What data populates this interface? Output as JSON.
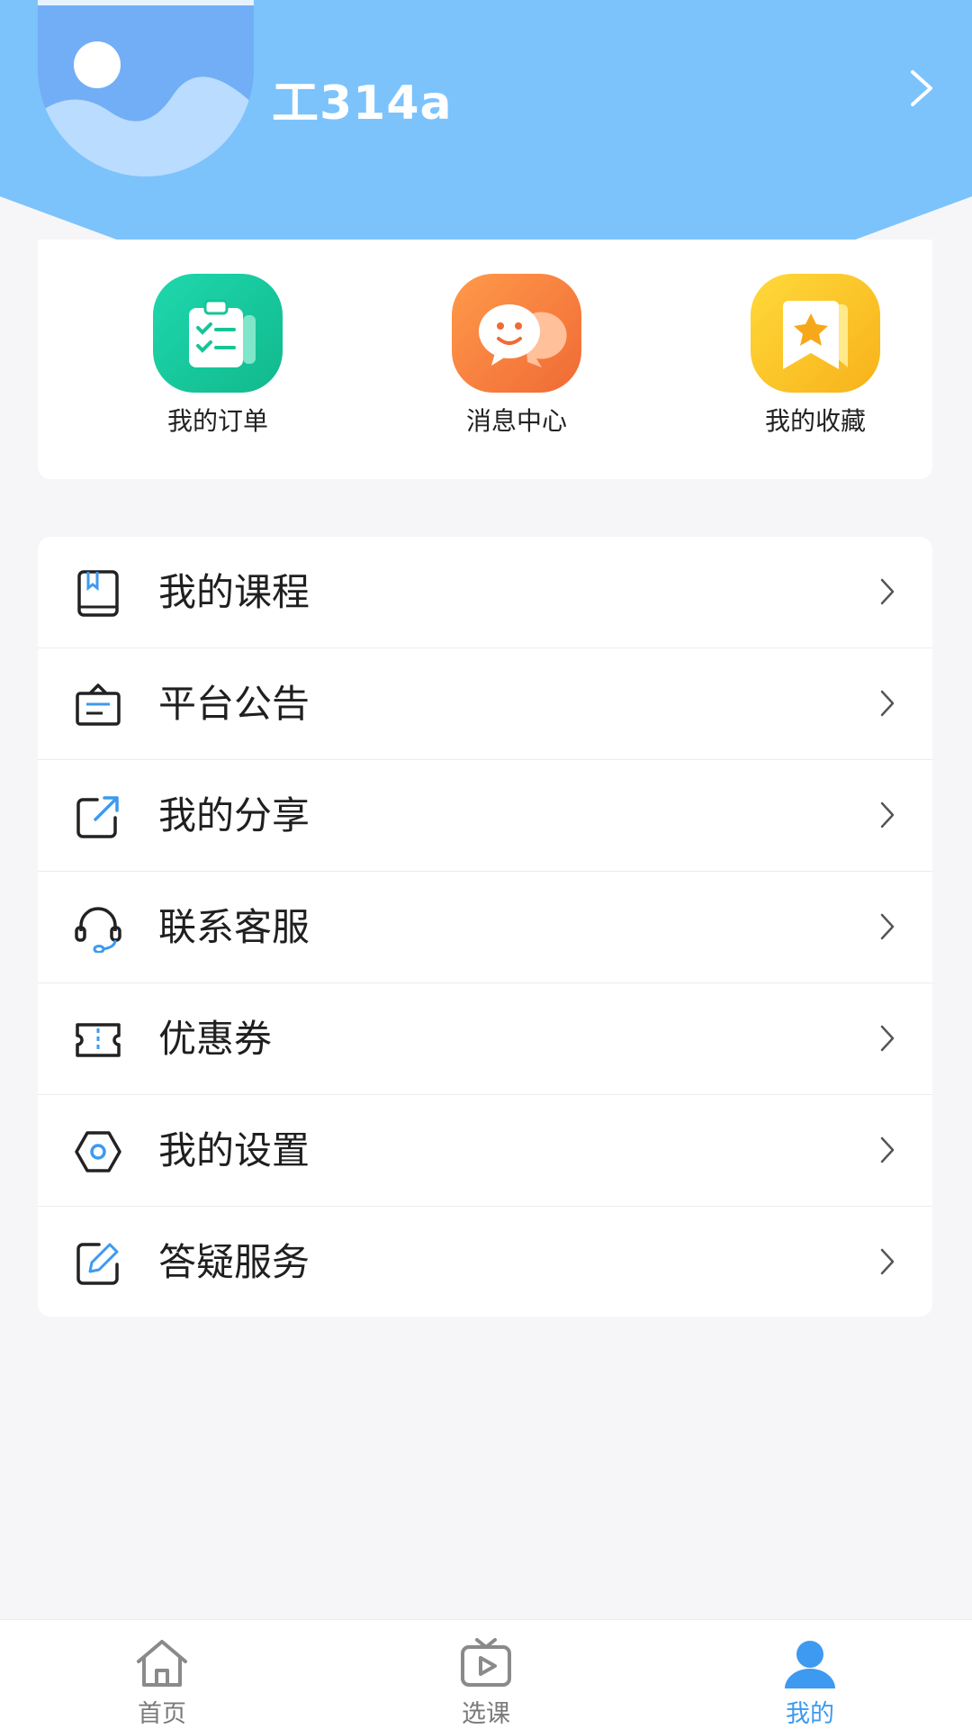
{
  "profile": {
    "username": "工314a"
  },
  "quick_actions": [
    {
      "label": "我的订单",
      "icon": "clipboard-checklist-icon",
      "color": "#19c9a0"
    },
    {
      "label": "消息中心",
      "icon": "chat-bubble-smile-icon",
      "color": "#f7753d"
    },
    {
      "label": "我的收藏",
      "icon": "bookmark-star-icon",
      "color": "#fbc21f"
    }
  ],
  "menu": [
    {
      "label": "我的课程",
      "icon": "book-icon"
    },
    {
      "label": "平台公告",
      "icon": "announcement-board-icon"
    },
    {
      "label": "我的分享",
      "icon": "share-icon"
    },
    {
      "label": "联系客服",
      "icon": "headset-icon"
    },
    {
      "label": "优惠券",
      "icon": "coupon-icon"
    },
    {
      "label": "我的设置",
      "icon": "settings-hexagon-icon"
    },
    {
      "label": "答疑服务",
      "icon": "edit-icon"
    }
  ],
  "tabs": [
    {
      "label": "首页",
      "icon": "home-icon",
      "active": false
    },
    {
      "label": "选课",
      "icon": "tv-play-icon",
      "active": false
    },
    {
      "label": "我的",
      "icon": "user-icon",
      "active": true
    }
  ],
  "colors": {
    "header": "#7cc3fc",
    "accent": "#3d9af0",
    "page_bg": "#f6f6f8"
  }
}
